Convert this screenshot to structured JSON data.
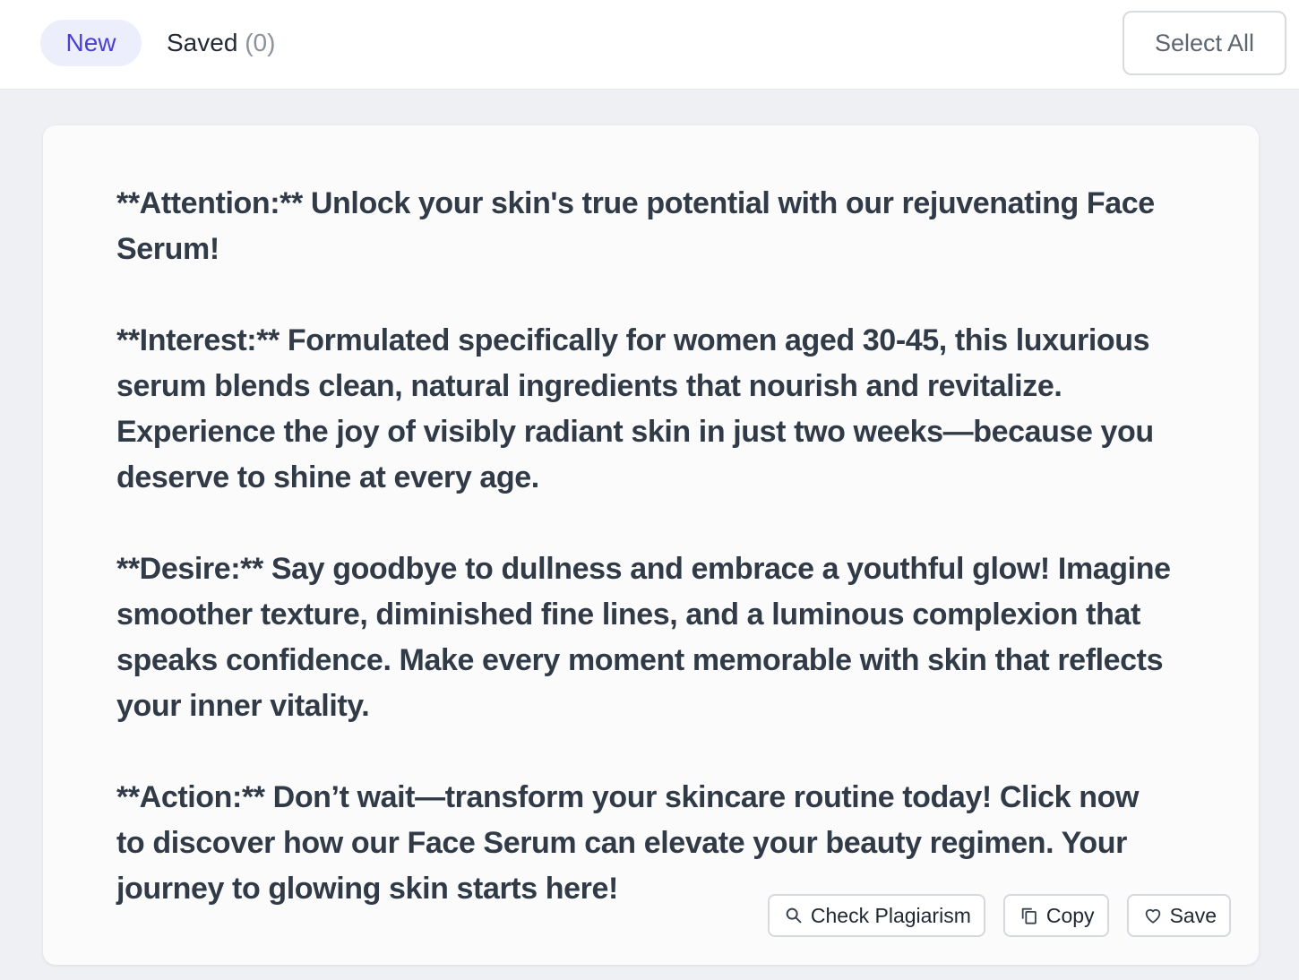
{
  "tabs": {
    "new_label": "New",
    "saved_label": "Saved",
    "saved_count": "(0)"
  },
  "toolbar": {
    "select_all_label": "Select All"
  },
  "result": {
    "paragraphs": [
      "**Attention:** Unlock your skin's true potential with our rejuvenating Face Serum!",
      "**Interest:** Formulated specifically for women aged 30-45, this luxurious serum blends clean, natural ingredients that nourish and revitalize. Experience the joy of visibly radiant skin in just two weeks—because you deserve to shine at every age.",
      "**Desire:** Say goodbye to dullness and embrace a youthful glow! Imagine smoother texture, diminished fine lines, and a luminous complexion that speaks confidence. Make every moment memorable with skin that reflects your inner vitality.",
      "**Action:** Don’t wait—transform your skincare routine today! Click now to discover how our Face Serum can elevate your beauty regimen. Your journey to glowing skin starts here!"
    ]
  },
  "actions": {
    "check_plagiarism_label": "Check Plagiarism",
    "copy_label": "Copy",
    "save_label": "Save"
  },
  "icons": {
    "check_plagiarism": "search-icon",
    "copy": "copy-icon",
    "save": "heart-icon"
  },
  "colors": {
    "accent": "#4a3fd6",
    "active_tab_bg": "#eceefc",
    "page_bg": "#eef0f3"
  }
}
